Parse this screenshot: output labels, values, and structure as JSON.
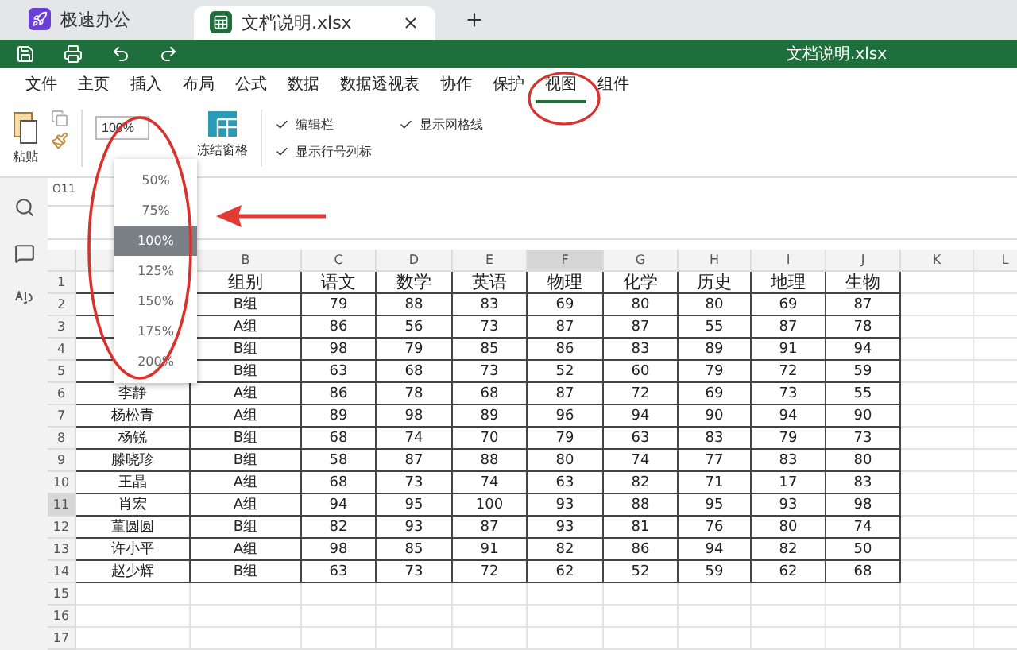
{
  "tabs": [
    {
      "label": "极速办公",
      "kind": "home",
      "selected": false
    },
    {
      "label": "文档说明.xlsx",
      "kind": "sheet",
      "selected": true
    }
  ],
  "title_bar": {
    "title": "文档说明.xlsx"
  },
  "menu": [
    {
      "label": "文件",
      "selected": false
    },
    {
      "label": "主页",
      "selected": false
    },
    {
      "label": "插入",
      "selected": false
    },
    {
      "label": "布局",
      "selected": false
    },
    {
      "label": "公式",
      "selected": false
    },
    {
      "label": "数据",
      "selected": false
    },
    {
      "label": "数据透视表",
      "selected": false
    },
    {
      "label": "协作",
      "selected": false
    },
    {
      "label": "保护",
      "selected": false
    },
    {
      "label": "视图",
      "selected": true
    },
    {
      "label": "组件",
      "selected": false
    }
  ],
  "ribbon": {
    "paste": "粘贴",
    "zoom": "100%",
    "freeze": "冻结窗格",
    "checks": [
      {
        "label": "编辑栏",
        "checked": true
      },
      {
        "label": "显示网格线",
        "checked": true
      },
      {
        "label": "显示行号列标",
        "checked": true
      }
    ]
  },
  "zoom_menu": [
    {
      "label": "50%",
      "selected": false
    },
    {
      "label": "75%",
      "selected": false
    },
    {
      "label": "100%",
      "selected": true
    },
    {
      "label": "125%",
      "selected": false
    },
    {
      "label": "150%",
      "selected": false
    },
    {
      "label": "175%",
      "selected": false
    },
    {
      "label": "200%",
      "selected": false
    }
  ],
  "name_box": "O11",
  "sheet": {
    "columns": [
      {
        "label": "B",
        "selected": false
      },
      {
        "label": "C",
        "selected": false
      },
      {
        "label": "D",
        "selected": false
      },
      {
        "label": "E",
        "selected": false
      },
      {
        "label": "F",
        "selected": true
      },
      {
        "label": "G",
        "selected": false
      },
      {
        "label": "H",
        "selected": false
      },
      {
        "label": "I",
        "selected": false
      },
      {
        "label": "J",
        "selected": false
      },
      {
        "label": "K",
        "selected": false
      },
      {
        "label": "L",
        "selected": false
      }
    ],
    "rows": [
      {
        "num": "1",
        "selected": false,
        "cells": [
          "组别",
          "语文",
          "数学",
          "英语",
          "物理",
          "化学",
          "历史",
          "地理",
          "生物"
        ]
      },
      {
        "num": "2",
        "selected": false,
        "cells": [
          "B组",
          "79",
          "88",
          "83",
          "69",
          "80",
          "80",
          "69",
          "87"
        ]
      },
      {
        "num": "3",
        "selected": false,
        "cells": [
          "A组",
          "86",
          "56",
          "73",
          "87",
          "87",
          "55",
          "87",
          "78"
        ]
      },
      {
        "num": "4",
        "selected": false,
        "cells": [
          "B组",
          "98",
          "79",
          "85",
          "86",
          "83",
          "89",
          "91",
          "94"
        ]
      },
      {
        "num": "5",
        "selected": false,
        "cells": [
          "B组",
          "63",
          "68",
          "73",
          "52",
          "60",
          "79",
          "72",
          "59"
        ]
      },
      {
        "num": "6",
        "selected": false,
        "name": "李静",
        "cells": [
          "A组",
          "86",
          "78",
          "68",
          "87",
          "72",
          "69",
          "73",
          "55"
        ]
      },
      {
        "num": "7",
        "selected": false,
        "name": "杨松青",
        "cells": [
          "A组",
          "89",
          "98",
          "89",
          "96",
          "94",
          "90",
          "94",
          "90"
        ]
      },
      {
        "num": "8",
        "selected": false,
        "name": "杨锐",
        "cells": [
          "B组",
          "68",
          "74",
          "70",
          "79",
          "63",
          "83",
          "79",
          "73"
        ]
      },
      {
        "num": "9",
        "selected": false,
        "name": "滕晓珍",
        "cells": [
          "B组",
          "58",
          "87",
          "88",
          "80",
          "74",
          "77",
          "83",
          "80"
        ]
      },
      {
        "num": "10",
        "selected": false,
        "name": "王晶",
        "cells": [
          "A组",
          "68",
          "73",
          "74",
          "63",
          "82",
          "71",
          "17",
          "83"
        ]
      },
      {
        "num": "11",
        "selected": true,
        "name": "肖宏",
        "cells": [
          "A组",
          "94",
          "95",
          "100",
          "93",
          "88",
          "95",
          "93",
          "98"
        ]
      },
      {
        "num": "12",
        "selected": false,
        "name": "董圆圆",
        "cells": [
          "B组",
          "82",
          "93",
          "87",
          "93",
          "81",
          "76",
          "80",
          "74"
        ]
      },
      {
        "num": "13",
        "selected": false,
        "name": "许小平",
        "cells": [
          "A组",
          "98",
          "85",
          "91",
          "82",
          "86",
          "94",
          "82",
          "50"
        ]
      },
      {
        "num": "14",
        "selected": false,
        "name": "赵少辉",
        "cells": [
          "B组",
          "63",
          "73",
          "72",
          "62",
          "52",
          "59",
          "62",
          "68"
        ]
      },
      {
        "num": "15",
        "selected": false
      },
      {
        "num": "16",
        "selected": false
      },
      {
        "num": "17",
        "selected": false
      }
    ]
  }
}
